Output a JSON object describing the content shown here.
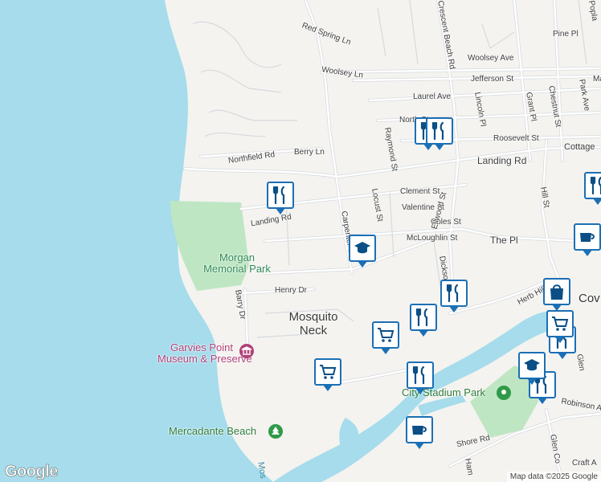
{
  "map": {
    "place_name": "Mosquito\nNeck",
    "park_name": "Morgan\nMemorial Park",
    "pois": {
      "museum": "Garvies Point\nMuseum & Preserve",
      "beach": "Mercadante Beach",
      "stadium": "City Stadium Park"
    },
    "water_label": "Mos",
    "cove_label": "Cov",
    "streets": {
      "red_spring_ln": "Red Spring Ln",
      "woolsey_ln": "Woolsey Ln",
      "woolsey_ave": "Woolsey Ave",
      "jefferson_st": "Jefferson St",
      "laurel_ave": "Laurel Ave",
      "north_st": "North St",
      "roosevelt_st": "Roosevelt St",
      "cottage": "Cottage",
      "northfield_rd": "Northfield Rd",
      "berry_ln": "Berry Ln",
      "landing_rd_west": "Landing Rd",
      "landing_rd_east": "Landing Rd",
      "clement_st": "Clement St",
      "valentine_st": "Valentine St",
      "coles_st": "Coles St",
      "mcloughlin_st": "McLoughlin St",
      "the_pl": "The Pl",
      "herb_hill_rd": "Herb Hill Rd",
      "henry_dr": "Henry Dr",
      "barry_dr": "Barry Dr",
      "shore_rd_partial": "Shore Rd",
      "crescent_beach_rd": "Crescent Beach Rd",
      "raymond_st": "Raymond St",
      "locust_st": "Locust St",
      "carpenter_st": "Carpenter St",
      "ellwood_st": "Ellwood St",
      "dickson": "Dickso",
      "lincoln_pl": "Lincoln Pl",
      "grant_pl": "Grant Pl",
      "chestnut_st": "Chestnut St",
      "park_ave": "Park Ave",
      "pine_pl": "Pine Pl",
      "hill_st": "Hill St",
      "robinson_av": "Robinson Av",
      "glen_co": "Glen Co",
      "craft_a": "Craft A",
      "ham": "Ham",
      "glen_partial": "Glen",
      "ma": "Ma",
      "popla": "Popla",
      "shore_vertical": "Shore Rd"
    },
    "markers": [
      {
        "id": "marker-restaurant-1",
        "icon": "restaurant"
      },
      {
        "id": "marker-restaurant-2",
        "icon": "restaurant"
      },
      {
        "id": "marker-restaurant-3",
        "icon": "restaurant"
      },
      {
        "id": "marker-restaurant-4",
        "icon": "restaurant"
      },
      {
        "id": "marker-restaurant-5",
        "icon": "restaurant"
      },
      {
        "id": "marker-restaurant-6",
        "icon": "restaurant"
      },
      {
        "id": "marker-restaurant-7",
        "icon": "restaurant"
      },
      {
        "id": "marker-restaurant-8",
        "icon": "restaurant"
      },
      {
        "id": "marker-restaurant-9",
        "icon": "restaurant"
      },
      {
        "id": "marker-school-1",
        "icon": "school"
      },
      {
        "id": "marker-school-2",
        "icon": "school"
      },
      {
        "id": "marker-grocery-1",
        "icon": "grocery"
      },
      {
        "id": "marker-grocery-2",
        "icon": "grocery"
      },
      {
        "id": "marker-grocery-3",
        "icon": "grocery"
      },
      {
        "id": "marker-cafe-1",
        "icon": "cafe"
      },
      {
        "id": "marker-cafe-2",
        "icon": "cafe"
      },
      {
        "id": "marker-shopping-1",
        "icon": "shopping"
      }
    ],
    "colors": {
      "water": "#a6dceb",
      "land": "#f4f3f0",
      "park": "#bfe6c3",
      "road": "#ffffff",
      "road_casing": "#d6d9dd",
      "marker_border": "#1b6fb5"
    }
  },
  "attribution": {
    "logo": "Google",
    "text": "Map data ©2025 Google"
  }
}
